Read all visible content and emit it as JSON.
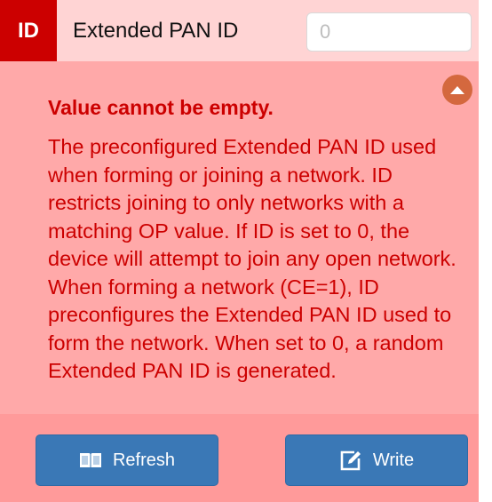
{
  "header": {
    "badge": "ID",
    "parameter_name": "Extended PAN ID",
    "input_value": "",
    "input_placeholder": "0"
  },
  "error": "Value cannot be empty.",
  "description": {
    "paragraph1": "The preconfigured Extended PAN ID used when forming or joining a network. ID restricts joining to only networks with a matching OP value. If ID is set to 0, the device will attempt to join any open network.",
    "paragraph2": "When forming a network (CE=1), ID preconfigures the Extended PAN ID used to form the network. When set to 0, a random Extended PAN ID is generated."
  },
  "buttons": {
    "refresh_label": "Refresh",
    "refresh_icon": "book-icon",
    "write_label": "Write",
    "write_icon": "edit-icon"
  },
  "collapse_icon": "chevron-up-circle-icon",
  "colors": {
    "badge_red": "#cc0000",
    "panel_bg": "#ffa9a9",
    "header_bg": "#ffd4d4",
    "error_text": "#cc0000",
    "collapse_orange": "#d4683e",
    "button_blue": "#3a78b6"
  }
}
